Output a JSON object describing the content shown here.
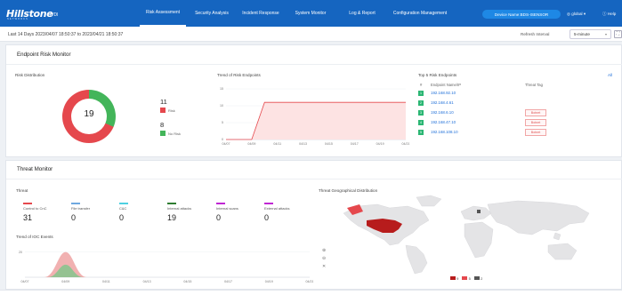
{
  "header": {
    "logo": "Hillstone",
    "logo_sub": "NETWORKS",
    "product": "iVDI",
    "nav": [
      {
        "label": "Risk Assessment",
        "active": true
      },
      {
        "label": "Security Analysis",
        "active": false
      },
      {
        "label": "Incident Response",
        "active": false
      },
      {
        "label": "System Monitor",
        "active": false
      },
      {
        "label": "Log & Report",
        "active": false
      },
      {
        "label": "Configuration Management",
        "active": false
      }
    ],
    "device": "Device Name:BDS-ISENSOR",
    "user": "global",
    "help": "Help"
  },
  "subheader": {
    "date_range": "Last 14 Days 2023/04/07 18:50:37 to 2023/04/21 18:50:37",
    "refresh_label": "Refresh Interval",
    "refresh_value": "5-minute"
  },
  "endpoint_risk": {
    "title": "Endpoint Risk Monitor",
    "distribution": {
      "label": "Risk Distribution",
      "total": "19",
      "risk_count": "11",
      "risk_label": "Risk",
      "norisk_count": "8",
      "norisk_label": "No Risk",
      "risk_color": "#e5484d",
      "norisk_color": "#43b55a"
    },
    "trend_label": "Trend of Risk Endpoints",
    "top5": {
      "label": "Top 5 Risk Endpoints",
      "all_link": "All",
      "col_index": "#",
      "col_name": "Endpoint Name/IP",
      "col_tag": "Threat Tag",
      "rows": [
        {
          "index": "1",
          "ip": "192.168.92.10",
          "tag": ""
        },
        {
          "index": "2",
          "ip": "192.168.4.61",
          "tag": ""
        },
        {
          "index": "3",
          "ip": "192.168.6.10",
          "tag": "Botnet"
        },
        {
          "index": "4",
          "ip": "192.168.47.10",
          "tag": "Botnet"
        },
        {
          "index": "5",
          "ip": "192.168.108.10",
          "tag": "Botnet"
        }
      ]
    }
  },
  "threat_monitor": {
    "title": "Threat Monitor",
    "threat_label": "Threat",
    "items": [
      {
        "label": "Control to CnC",
        "value": "31",
        "color": "#e5484d"
      },
      {
        "label": "File transfer",
        "value": "0",
        "color": "#6ea8e0"
      },
      {
        "label": "C&C",
        "value": "0",
        "color": "#4dd0e1"
      },
      {
        "label": "Internal attacks",
        "value": "19",
        "color": "#2e7d32"
      },
      {
        "label": "Internal scans",
        "value": "0",
        "color": "#c026d3"
      },
      {
        "label": "External attacks",
        "value": "0",
        "color": "#c026d3"
      }
    ],
    "ioc_label": "Trend of IOC Events",
    "geo_label": "Threat Geographical Distribution",
    "map_legend": [
      {
        "value": "9",
        "color": "#b71c1c"
      },
      {
        "value": "5",
        "color": "#e5484d"
      },
      {
        "value": "2",
        "color": "#555555"
      }
    ]
  },
  "chart_data": [
    {
      "type": "area",
      "title": "Trend of Risk Endpoints",
      "x": [
        "04/07",
        "04/09",
        "04/11",
        "04/13",
        "04/15",
        "04/17",
        "04/19",
        "04/21"
      ],
      "y_ticks": [
        "0",
        "5",
        "10",
        "15"
      ],
      "ylim": [
        0,
        15
      ],
      "series": [
        {
          "values": [
            0,
            0,
            11,
            11,
            11,
            11,
            11,
            11
          ]
        }
      ],
      "step_point": {
        "from_x": "04/09",
        "to_x": "04/10",
        "from_y": 0,
        "to_y": 11
      },
      "color": "#e5484d"
    },
    {
      "type": "area",
      "title": "Trend of IOC Events",
      "x": [
        "04/07",
        "04/09",
        "04/11",
        "04/13",
        "04/15",
        "04/17",
        "04/19",
        "04/21"
      ],
      "y_ticks": [
        "20"
      ],
      "ylim": [
        0,
        24
      ],
      "series": [
        {
          "color": "#f0a8a8",
          "peak_x": "04/09",
          "peak_y": 20
        },
        {
          "color": "#8bc48f",
          "peak_x": "04/09",
          "peak_y": 10
        }
      ]
    }
  ]
}
